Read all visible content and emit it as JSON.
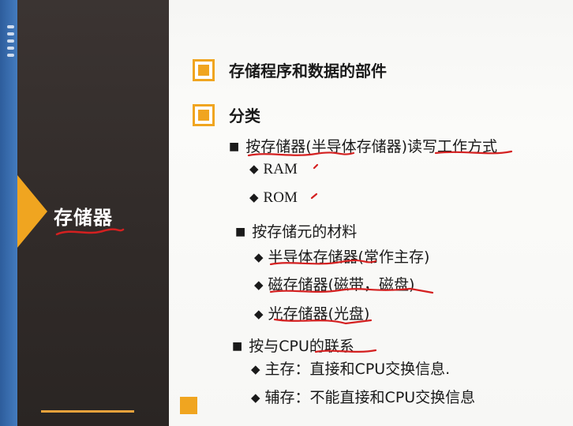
{
  "sidebar": {
    "title": "存储器"
  },
  "sections": [
    {
      "label": "存储程序和数据的部件"
    },
    {
      "label": "分类"
    }
  ],
  "items": {
    "by_rw_mode": "按存储器(半导体存储器)读写工作方式",
    "ram": "RAM",
    "rom": "ROM",
    "by_material": "按存储元的材料",
    "semiconductor": "半导体存储器(常作主存)",
    "magnetic": "磁存储器(磁带，磁盘)",
    "optical": "光存储器(光盘)",
    "by_cpu": "按与CPU的联系",
    "main_memory": "主存：直接和CPU交换信息.",
    "aux_memory": "辅存：不能直接和CPU交换信息"
  },
  "icons": {
    "section_box": "square-bullet-icon",
    "level1_bullet": "black-square-bullet-icon",
    "level2_bullet": "black-diamond-bullet-icon",
    "sidebar_arrow": "orange-arrow-icon"
  },
  "colors": {
    "accent": "#f0a520",
    "sidebar": "#342e2c",
    "annotation": "#d42020"
  }
}
